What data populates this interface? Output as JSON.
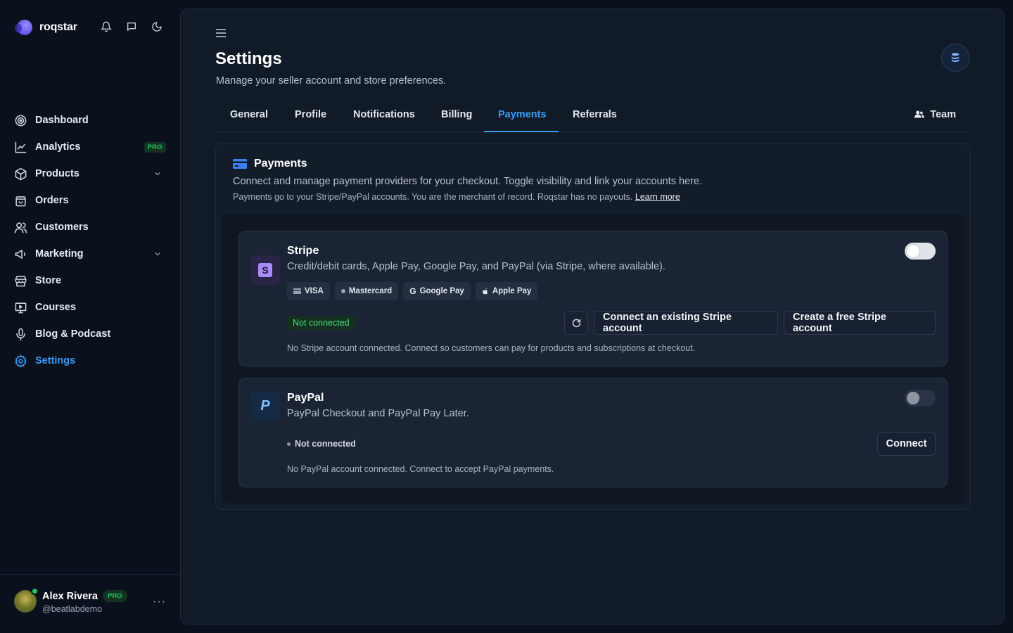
{
  "brand": {
    "name": "roqstar"
  },
  "top_icons": [
    "bell-icon",
    "message-icon",
    "moon-icon"
  ],
  "sidebar": {
    "items": [
      {
        "label": "Dashboard",
        "icon": "dashboard-icon"
      },
      {
        "label": "Analytics",
        "icon": "chart-line-icon",
        "badge": "PRO"
      },
      {
        "label": "Products",
        "icon": "box-icon",
        "expandable": true
      },
      {
        "label": "Orders",
        "icon": "bag-icon"
      },
      {
        "label": "Customers",
        "icon": "users-icon"
      },
      {
        "label": "Marketing",
        "icon": "megaphone-icon",
        "expandable": true
      },
      {
        "label": "Store",
        "icon": "store-icon"
      },
      {
        "label": "Courses",
        "icon": "presentation-icon"
      },
      {
        "label": "Blog & Podcast",
        "icon": "mic-icon"
      },
      {
        "label": "Settings",
        "icon": "gear-icon",
        "active": true
      }
    ]
  },
  "user": {
    "name": "Alex Rivera",
    "badge": "PRO",
    "handle": "@beatlabdemo",
    "more": "···"
  },
  "header": {
    "title": "Settings",
    "subtitle": "Manage your seller account and store preferences."
  },
  "tabs": [
    {
      "label": "General"
    },
    {
      "label": "Profile"
    },
    {
      "label": "Notifications"
    },
    {
      "label": "Billing"
    },
    {
      "label": "Payments",
      "active": true
    },
    {
      "label": "Referrals"
    }
  ],
  "team_label": "Team",
  "payments": {
    "title": "Payments",
    "description": "Connect and manage payment providers for your checkout. Toggle visibility and link your accounts here.",
    "note": "Payments go to your Stripe/PayPal accounts. You are the merchant of record. Roqstar has no payouts.",
    "learn_more": "Learn more"
  },
  "stripe": {
    "logo_letter": "S",
    "name": "Stripe",
    "description": "Credit/debit cards, Apple Pay, Google Pay, and PayPal (via Stripe, where available).",
    "methods": [
      "VISA",
      "Mastercard",
      "Google Pay",
      "Apple Pay"
    ],
    "status": "Not connected",
    "connect_existing": "Connect an existing Stripe account",
    "create_free": "Create a free Stripe account",
    "footer": "No Stripe account connected. Connect so customers can pay for products and subscriptions at checkout.",
    "enabled": false
  },
  "paypal": {
    "logo_letter": "P",
    "name": "PayPal",
    "description": "PayPal Checkout and PayPal Pay Later.",
    "status": "Not connected",
    "connect": "Connect",
    "footer": "No PayPal account connected. Connect to accept PayPal payments.",
    "enabled": false
  },
  "colors": {
    "accent": "#3b9dfa",
    "pro_green": "#22c55e",
    "stripe_purple": "#a78bfa",
    "paypal_blue": "#60a5fa"
  }
}
